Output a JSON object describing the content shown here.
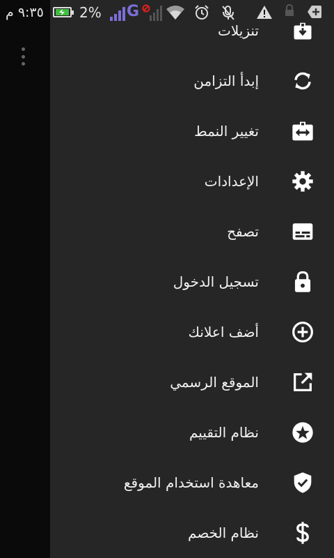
{
  "status_bar": {
    "time": "٩:٣٥ م",
    "battery_percent": "2%",
    "network_type": "G"
  },
  "menu": {
    "items": [
      {
        "label": "تنزيلات",
        "icon": "download-box-icon"
      },
      {
        "label": "إبدأ التزامن",
        "icon": "sync-icon"
      },
      {
        "label": "تغيير النمط",
        "icon": "swap-horizontal-icon"
      },
      {
        "label": "الإعدادات",
        "icon": "gear-icon"
      },
      {
        "label": "تصفح",
        "icon": "card-icon"
      },
      {
        "label": "تسجيل الدخول",
        "icon": "lock-icon"
      },
      {
        "label": "أضف اعلانك",
        "icon": "add-circle-icon"
      },
      {
        "label": "الموقع الرسمي",
        "icon": "external-link-icon"
      },
      {
        "label": "نظام التقييم",
        "icon": "star-circle-icon"
      },
      {
        "label": "معاهدة استخدام الموقع",
        "icon": "shield-check-icon"
      },
      {
        "label": "نظام الخصم",
        "icon": "dollar-icon"
      }
    ]
  }
}
